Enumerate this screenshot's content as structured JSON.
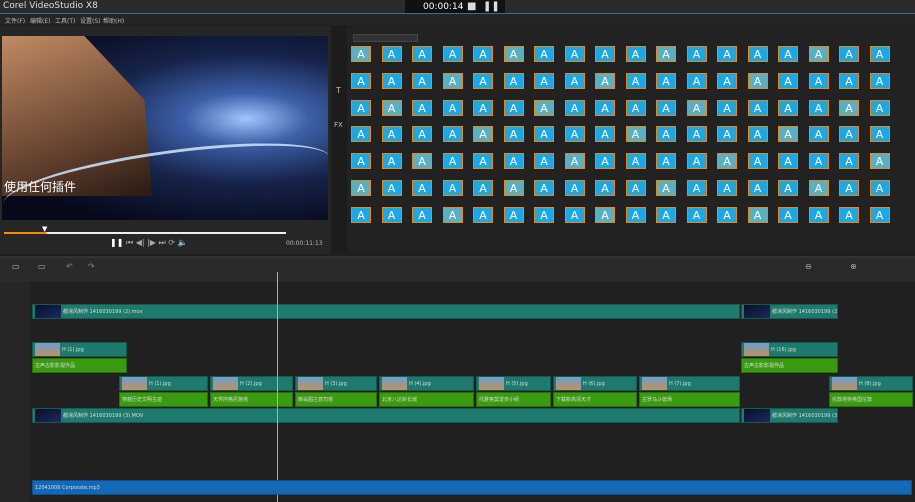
{
  "app": {
    "title": "Corel VideoStudio X8",
    "record_time": "00:00:14"
  },
  "menu": [
    "文件(F)",
    "编辑(E)",
    "工具(T)",
    "设置(S)",
    "帮助(H)"
  ],
  "preview": {
    "subtitle": "使用任何插件",
    "timecode": "00:00:11:13",
    "progress": 0.15
  },
  "library": {
    "rows": 7,
    "cols": 18,
    "glyph": "A"
  },
  "timeline": {
    "video_clips": [
      {
        "label": "都滑风制作 1416030199 (2).mov",
        "track": 0,
        "start": 32,
        "end": 740
      },
      {
        "label": "都滑风制作 1416030199 (2).MOV",
        "track": 0,
        "start": 741,
        "end": 838
      },
      {
        "label": "都滑风制作 1416030199 (3).MOV",
        "track": 5,
        "start": 32,
        "end": 740
      },
      {
        "label": "都滑风制作 1416030199 (3).MOV",
        "track": 5,
        "start": 741,
        "end": 838
      }
    ],
    "image_clips": [
      {
        "label": "H (1).jpg",
        "track": 1,
        "start": 32,
        "end": 127
      },
      {
        "label": "H (16).jpg",
        "track": 1,
        "start": 741,
        "end": 838
      },
      {
        "label": "H (1).jpg",
        "track": 3,
        "start": 119,
        "end": 208
      },
      {
        "label": "H (2).jpg",
        "track": 3,
        "start": 210,
        "end": 293
      },
      {
        "label": "H (3).jpg",
        "track": 3,
        "start": 295,
        "end": 377
      },
      {
        "label": "H (4).jpg",
        "track": 3,
        "start": 379,
        "end": 474
      },
      {
        "label": "H (5).jpg",
        "track": 3,
        "start": 476,
        "end": 551
      },
      {
        "label": "H (6).jpg",
        "track": 3,
        "start": 553,
        "end": 637
      },
      {
        "label": "H (7).jpg",
        "track": 3,
        "start": 639,
        "end": 740
      },
      {
        "label": "H (8).jpg",
        "track": 3,
        "start": 829,
        "end": 913
      }
    ],
    "title_clips": [
      {
        "label": "古声古影影视作品",
        "track": 2,
        "start": 32,
        "end": 127
      },
      {
        "label": "古声古影影视作品",
        "track": 2,
        "start": 741,
        "end": 838
      },
      {
        "label": "穿越历史文明古迹",
        "track": 4,
        "start": 119,
        "end": 208
      },
      {
        "label": "天界阿格尼施塔",
        "track": 4,
        "start": 210,
        "end": 293
      },
      {
        "label": "麻翁图古普司塔",
        "track": 4,
        "start": 295,
        "end": 377
      },
      {
        "label": "北京八达岭长城",
        "track": 4,
        "start": 379,
        "end": 474
      },
      {
        "label": "托雅格莫雷奈小组",
        "track": 4,
        "start": 476,
        "end": 551
      },
      {
        "label": "下载新高清天才",
        "track": 4,
        "start": 553,
        "end": 637
      },
      {
        "label": "古罗马斗兽场",
        "track": 4,
        "start": 639,
        "end": 740
      },
      {
        "label": "伦敦塔桥英国伦敦",
        "track": 4,
        "start": 829,
        "end": 913
      }
    ],
    "audio_clip": {
      "label": "12041006 Corporate.mp3"
    }
  },
  "colors": {
    "video": "#1d7a6c",
    "title": "#3a9a10",
    "audio": "#1468b8",
    "thumb": "#1ea7e0"
  }
}
